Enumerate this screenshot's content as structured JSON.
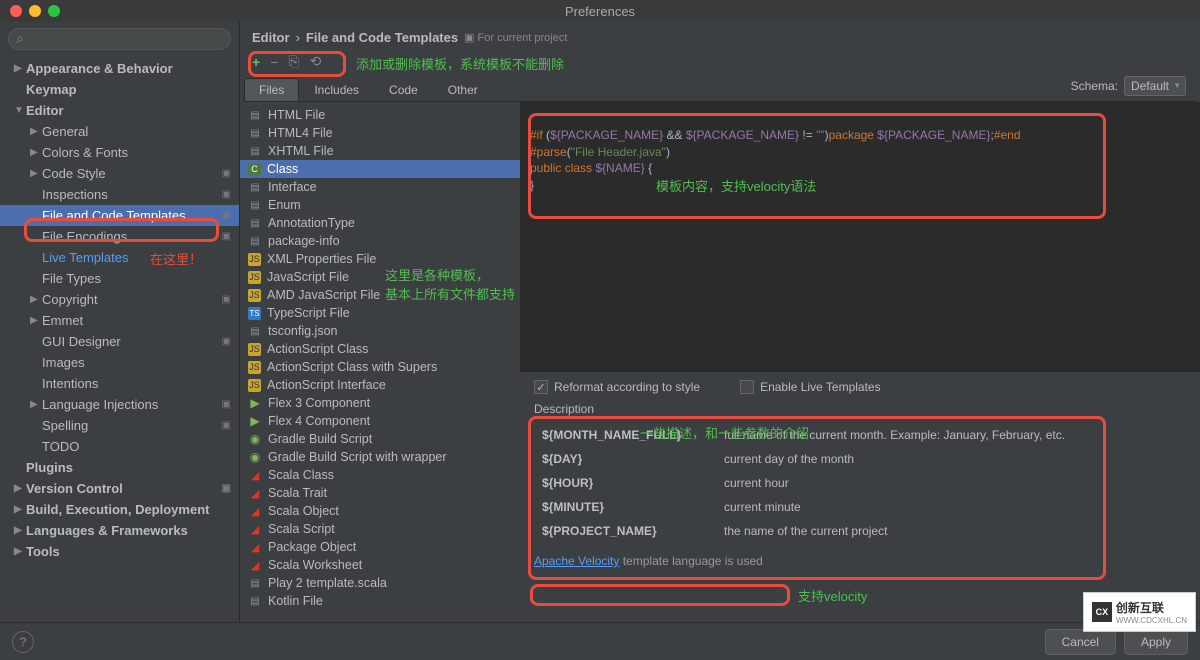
{
  "window_title": "Preferences",
  "breadcrumb": {
    "main": "Editor",
    "sub": "File and Code Templates",
    "scope": "For current project"
  },
  "schema": {
    "label": "Schema:",
    "value": "Default"
  },
  "sidebar": {
    "items": [
      {
        "label": "Appearance & Behavior",
        "type": "collapsed",
        "bold": true
      },
      {
        "label": "Keymap",
        "type": "none",
        "bold": true
      },
      {
        "label": "Editor",
        "type": "expanded",
        "bold": true
      },
      {
        "label": "General",
        "type": "collapsed",
        "indent": 1
      },
      {
        "label": "Colors & Fonts",
        "type": "collapsed",
        "indent": 1
      },
      {
        "label": "Code Style",
        "type": "collapsed",
        "indent": 1,
        "scope": true
      },
      {
        "label": "Inspections",
        "type": "none",
        "indent": 1,
        "scope": true
      },
      {
        "label": "File and Code Templates",
        "type": "none",
        "indent": 1,
        "scope": true,
        "selected": true
      },
      {
        "label": "File Encodings",
        "type": "none",
        "indent": 1,
        "scope": true
      },
      {
        "label": "Live Templates",
        "type": "none",
        "indent": 1,
        "highlight": true
      },
      {
        "label": "File Types",
        "type": "none",
        "indent": 1
      },
      {
        "label": "Copyright",
        "type": "collapsed",
        "indent": 1,
        "scope": true
      },
      {
        "label": "Emmet",
        "type": "collapsed",
        "indent": 1
      },
      {
        "label": "GUI Designer",
        "type": "none",
        "indent": 1,
        "scope": true
      },
      {
        "label": "Images",
        "type": "none",
        "indent": 1
      },
      {
        "label": "Intentions",
        "type": "none",
        "indent": 1
      },
      {
        "label": "Language Injections",
        "type": "collapsed",
        "indent": 1,
        "scope": true
      },
      {
        "label": "Spelling",
        "type": "none",
        "indent": 1,
        "scope": true
      },
      {
        "label": "TODO",
        "type": "none",
        "indent": 1
      },
      {
        "label": "Plugins",
        "type": "none",
        "bold": true
      },
      {
        "label": "Version Control",
        "type": "collapsed",
        "bold": true,
        "scope": true
      },
      {
        "label": "Build, Execution, Deployment",
        "type": "collapsed",
        "bold": true
      },
      {
        "label": "Languages & Frameworks",
        "type": "collapsed",
        "bold": true
      },
      {
        "label": "Tools",
        "type": "collapsed",
        "bold": true
      }
    ]
  },
  "tabs": [
    "Files",
    "Includes",
    "Code",
    "Other"
  ],
  "active_tab": "Files",
  "templates": [
    {
      "label": "HTML File",
      "icon": "file"
    },
    {
      "label": "HTML4 File",
      "icon": "file"
    },
    {
      "label": "XHTML File",
      "icon": "file"
    },
    {
      "label": "Class",
      "icon": "class",
      "selected": true
    },
    {
      "label": "Interface",
      "icon": "file"
    },
    {
      "label": "Enum",
      "icon": "file"
    },
    {
      "label": "AnnotationType",
      "icon": "file"
    },
    {
      "label": "package-info",
      "icon": "file"
    },
    {
      "label": "XML Properties File",
      "icon": "js"
    },
    {
      "label": "JavaScript File",
      "icon": "js"
    },
    {
      "label": "AMD JavaScript File",
      "icon": "js"
    },
    {
      "label": "TypeScript File",
      "icon": "ts"
    },
    {
      "label": "tsconfig.json",
      "icon": "file"
    },
    {
      "label": "ActionScript Class",
      "icon": "js"
    },
    {
      "label": "ActionScript Class with Supers",
      "icon": "js"
    },
    {
      "label": "ActionScript Interface",
      "icon": "js"
    },
    {
      "label": "Flex 3 Component",
      "icon": "play"
    },
    {
      "label": "Flex 4 Component",
      "icon": "play"
    },
    {
      "label": "Gradle Build Script",
      "icon": "gradle"
    },
    {
      "label": "Gradle Build Script with wrapper",
      "icon": "gradle"
    },
    {
      "label": "Scala Class",
      "icon": "scala"
    },
    {
      "label": "Scala Trait",
      "icon": "scala"
    },
    {
      "label": "Scala Object",
      "icon": "scala"
    },
    {
      "label": "Scala Script",
      "icon": "scala"
    },
    {
      "label": "Package Object",
      "icon": "scala"
    },
    {
      "label": "Scala Worksheet",
      "icon": "scala"
    },
    {
      "label": "Play 2 template.scala",
      "icon": "file"
    },
    {
      "label": "Kotlin File",
      "icon": "file"
    }
  ],
  "code": {
    "line1": "#if (${PACKAGE_NAME} && ${PACKAGE_NAME} != \"\")package ${PACKAGE_NAME};#end",
    "line2": "#parse(\"File Header.java\")",
    "line3": "public class ${NAME} {",
    "line4": "}"
  },
  "options": {
    "reformat": "Reformat according to style",
    "live": "Enable Live Templates"
  },
  "description_label": "Description",
  "desc_vars": [
    {
      "name": "${MONTH_NAME_FULL}",
      "desc": "full name of the current month. Example: January, February, etc."
    },
    {
      "name": "${DAY}",
      "desc": "current day of the month"
    },
    {
      "name": "${HOUR}",
      "desc": "current hour"
    },
    {
      "name": "${MINUTE}",
      "desc": "current minute"
    },
    {
      "name": "${PROJECT_NAME}",
      "desc": "the name of the current project"
    }
  ],
  "footer": {
    "link": "Apache Velocity",
    "rest": " template language is used"
  },
  "buttons": {
    "cancel": "Cancel",
    "apply": "Apply",
    "help": "?"
  },
  "annotations": {
    "a1": "添加或删除模板，系统模板不能删除",
    "a2": "在这里！",
    "a3": "这里是各种模板，\n基本上所有文件都支持",
    "a4": "模板内容，支持velocity语法",
    "a5": "一些描述，和一些参数的介绍",
    "a6": "支持velocity"
  },
  "watermark": {
    "brand": "创新互联",
    "sub": "WWW.CDCXHL.CN"
  }
}
